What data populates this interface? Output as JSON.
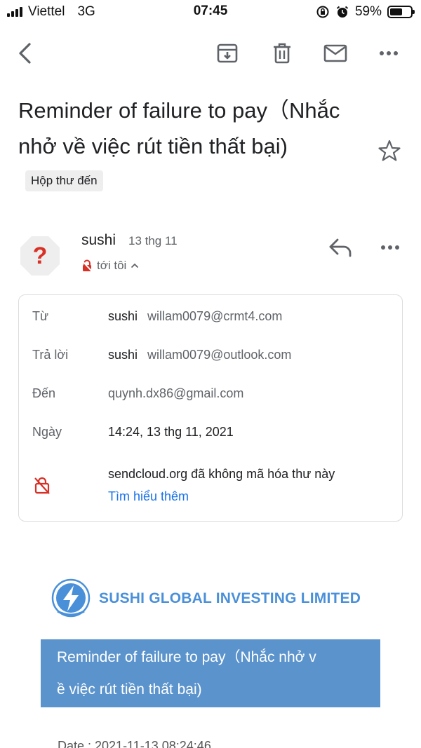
{
  "status_bar": {
    "carrier": "Viettel",
    "network": "3G",
    "time": "07:45",
    "battery_percent": "59%",
    "battery_level": 0.59,
    "icons": [
      "signal-icon",
      "lock-rotation-icon",
      "alarm-icon",
      "battery-icon"
    ]
  },
  "toolbar": {
    "icons": [
      "back-icon",
      "archive-icon",
      "delete-icon",
      "mark-unread-icon",
      "more-vert-icon"
    ]
  },
  "email": {
    "subject": "Reminder of failure to pay（Nhắc nhở về việc rút tiền thất bại)",
    "label": "Hộp thư đến",
    "sender": {
      "name": "sushi",
      "date": "13 thg 11",
      "avatar_glyph": "?",
      "to_me": "tới tôi"
    },
    "details": {
      "from_label": "Từ",
      "from_name": "sushi",
      "from_email": "willam0079@crmt4.com",
      "reply_label": "Trả lời",
      "reply_name": "sushi",
      "reply_email": "willam0079@outlook.com",
      "to_label": "Đến",
      "to_email": "quynh.dx86@gmail.com",
      "date_label": "Ngày",
      "date_value": "14:24, 13 thg 11, 2021",
      "encryption_text": "sendcloud.org đã không mã hóa thư này",
      "learn_more": "Tìm hiểu thêm"
    }
  },
  "body": {
    "company": "SUSHI GLOBAL INVESTING LIMITED",
    "banner_text": "Reminder of failure to pay（Nhắc nhở v\nề việc rút tiền thất bại)",
    "date_line": "Date : 2021-11-13 08:24:46"
  },
  "colors": {
    "accent_blue": "#1a73e8",
    "banner_blue": "#5b93cc",
    "company_blue": "#4a90d9",
    "warning_red": "#d93025"
  }
}
